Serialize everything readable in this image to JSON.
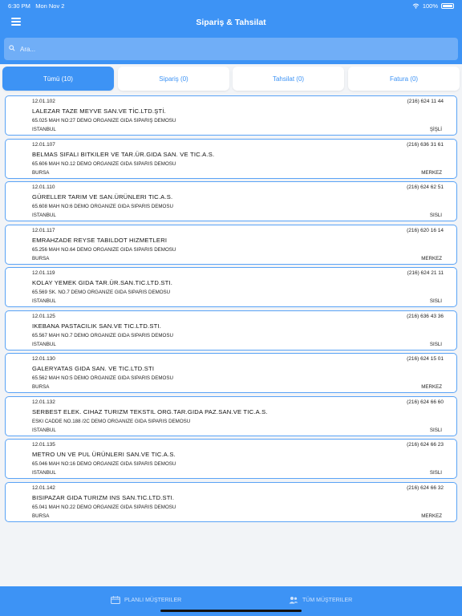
{
  "status": {
    "time": "6:30 PM",
    "date": "Mon Nov 2",
    "battery": "100%"
  },
  "header": {
    "title": "Sipariş & Tahsilat"
  },
  "search": {
    "placeholder": "Ara..."
  },
  "tabs": [
    {
      "label": "Tümü (10)"
    },
    {
      "label": "Sipariş (0)"
    },
    {
      "label": "Tahsilat (0)"
    },
    {
      "label": "Fatura (0)"
    }
  ],
  "customers": [
    {
      "code": "12.01.102",
      "phone": "(216) 624 11 44",
      "name": "LALEZAR TAZE MEYVE SAN.VE TİC.LTD.ŞTİ.",
      "address": "65.025 MAH NO:27 DEMO ORGANIZE GIDA SIPARIŞ DEMOSU",
      "city": "ISTANBUL",
      "district": "ŞİŞLİ"
    },
    {
      "code": "12.01.107",
      "phone": "(216) 636 31 61",
      "name": "BELMAS SIFALI BITKILER VE TAR.ÜR.GIDA SAN. VE TIC.A.S.",
      "address": "65.606 MAH NO.12 DEMO ORGANIZE GIDA SIPARIS DEMOSU",
      "city": "BURSA",
      "district": "MERKEZ"
    },
    {
      "code": "12.01.110",
      "phone": "(216) 624 62 51",
      "name": "GÜRELLER TARIM VE SAN.ÜRÜNLERI TIC.A.S.",
      "address": "65.608 MAH NO:6 DEMO ORGANIZE GIDA SIPARIS DEMOSU",
      "city": "ISTANBUL",
      "district": "SISLI"
    },
    {
      "code": "12.01.117",
      "phone": "(216) 620 16 14",
      "name": "EMRAHZADE REYSE TABILDOT HIZMETLERI",
      "address": "65.256 MAH NO.64 DEMO ORGANIZE GIDA SIPARIS DEMOSU",
      "city": "BURSA",
      "district": "MERKEZ"
    },
    {
      "code": "12.01.119",
      "phone": "(216) 624 21 11",
      "name": "KOLAY  YEMEK GIDA TAR.ÜR.SAN.TIC.LTD.STI.",
      "address": "65.569 SK. NO.7 DEMO ORGANIZE GIDA SIPARIS DEMOSU",
      "city": "ISTANBUL",
      "district": "SISLI"
    },
    {
      "code": "12.01.125",
      "phone": "(216) 636 43 36",
      "name": "IKEBANA PASTACILIK SAN.VE TIC.LTD.STI.",
      "address": "65.567 MAH NO.7 DEMO ORGANIZE GIDA SIPARIS DEMOSU",
      "city": "ISTANBUL",
      "district": "SISLI"
    },
    {
      "code": "12.01.130",
      "phone": "(216) 624 15 01",
      "name": "GALERYATAS GIDA SAN. VE TIC.LTD.STI",
      "address": "65.562 MAH NO:5 DEMO ORGANIZE GIDA SIPARIS DEMOSU",
      "city": "BURSA",
      "district": "MERKEZ"
    },
    {
      "code": "12.01.132",
      "phone": "(216) 624 66 60",
      "name": "SERBEST ELEK. CIHAZ TURIZM TEKSTIL ORG.TAR.GIDA PAZ.SAN.VE TIC.A.S.",
      "address": "ESKI CADDE NO.188 /2C DEMO ORGANIZE GIDA SIPARIS DEMOSU",
      "city": "ISTANBUL",
      "district": "SISLI"
    },
    {
      "code": "12.01.135",
      "phone": "(216) 624 66 23",
      "name": "METRO UN VE PUL ÜRÜNLERI SAN.VE TIC.A.S.",
      "address": "65.046 MAH NO:16 DEMO ORGANIZE GIDA SIPARIS DEMOSU",
      "city": "ISTANBUL",
      "district": "SISLI"
    },
    {
      "code": "12.01.142",
      "phone": "(216) 624 66 32",
      "name": "BISIPAZAR GIDA TURIZM INS SAN.TIC.LTD.STI.",
      "address": "65.041 MAH NO.22 DEMO ORGANIZE GIDA SIPARIS DEMOSU",
      "city": "BURSA",
      "district": "MERKEZ"
    }
  ],
  "bottom": {
    "planned_label": "PLANLI MÜŞTERILER",
    "all_label": "TÜM MÜŞTERILER"
  },
  "icons": {
    "menu": "menu-icon",
    "search": "search-icon",
    "calendar": "calendar-icon",
    "users": "users-icon",
    "wifi": "wifi-icon",
    "battery": "battery-icon"
  },
  "colors": {
    "primary": "#3d93f5",
    "background": "#f2f4f7",
    "card_border": "#5aa3f6"
  }
}
